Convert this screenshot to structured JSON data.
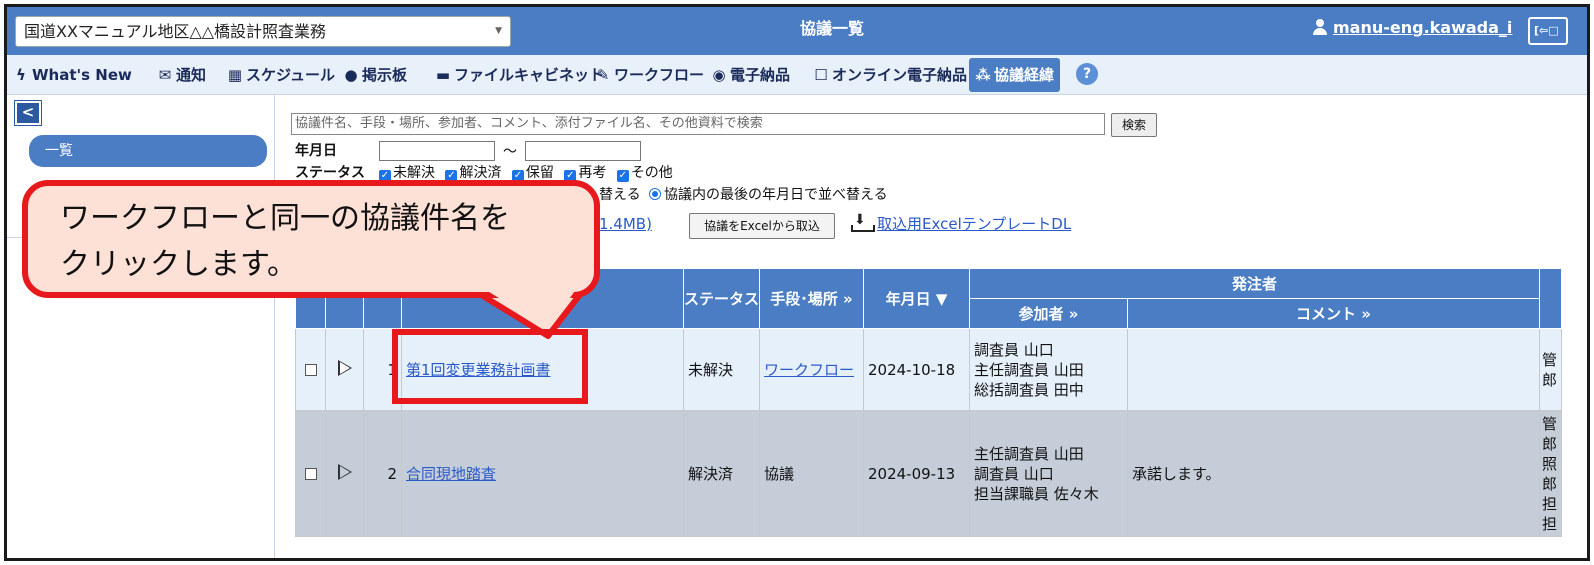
{
  "topbar": {
    "project": "国道XXマニュアル地区△△橋設計照査業務",
    "title": "協議一覧",
    "user": "manu-eng.kawada_i",
    "logout_label": "[⇦□"
  },
  "nav": {
    "items": [
      {
        "icon": "ϟ",
        "label": "What's New"
      },
      {
        "icon": "✉",
        "label": "通知"
      },
      {
        "icon": "▦",
        "label": "スケジュール"
      },
      {
        "icon": "●",
        "label": "掲示板"
      },
      {
        "icon": "▬",
        "label": "ファイルキャビネット"
      },
      {
        "icon": "✎",
        "label": "ワークフロー"
      },
      {
        "icon": "◉",
        "label": "電子納品"
      },
      {
        "icon": "☐",
        "label": "オンライン電子納品"
      },
      {
        "icon": "⁂",
        "label": "協議経緯"
      }
    ],
    "help": "?"
  },
  "sidebar": {
    "collapse": "<",
    "items": [
      "一覧"
    ]
  },
  "search": {
    "placeholder": "協議件名、手段・場所、参加者、コメント、添付ファイル名、その他資料で検索",
    "button": "検索",
    "date_label": "年月日",
    "date_sep": "〜",
    "status_label": "ステータス",
    "statuses": [
      "未解決",
      "解決済",
      "保留",
      "再考",
      "その他"
    ],
    "sort_partial": "替える",
    "sort_option": "協議内の最後の年月日で並べ替える",
    "download_partial": "1.4MB)",
    "import_button": "協議をExcelから取込",
    "template_link": "取込用ExcelテンプレートDL"
  },
  "table": {
    "headers": {
      "status": "ステータス",
      "method": "手段･場所",
      "method_more": "»",
      "date": "年月日",
      "date_sort": "▼",
      "orderer": "発注者",
      "participants": "参加者",
      "participants_more": "»",
      "comment": "コメント",
      "comment_more": "»"
    },
    "rows": [
      {
        "no": "1",
        "title": "第1回変更業務計画書",
        "status": "未解決",
        "method": "ワークフロー",
        "date": "2024-10-18",
        "participants": [
          "調査員 山口",
          "主任調査員 山田",
          "総括調査員 田中"
        ],
        "comment": "",
        "extra": [
          "管",
          "郎"
        ]
      },
      {
        "no": "2",
        "title": "合同現地踏査",
        "status": "解決済",
        "method": "協議",
        "date": "2024-09-13",
        "participants": [
          "主任調査員 山田",
          "調査員 山口",
          "担当課職員 佐々木"
        ],
        "comment": "承諾します。",
        "extra": [
          "管",
          "郎",
          "照",
          "郎",
          "担",
          "担"
        ]
      }
    ]
  },
  "callout": {
    "line1": "ワークフローと同一の協議件名を",
    "line2": "クリックします。"
  },
  "colors": {
    "header_blue": "#4a7dc4",
    "callout_red": "#e8191c",
    "callout_fill": "#fde0d6",
    "link_blue": "#2a5ac8"
  }
}
